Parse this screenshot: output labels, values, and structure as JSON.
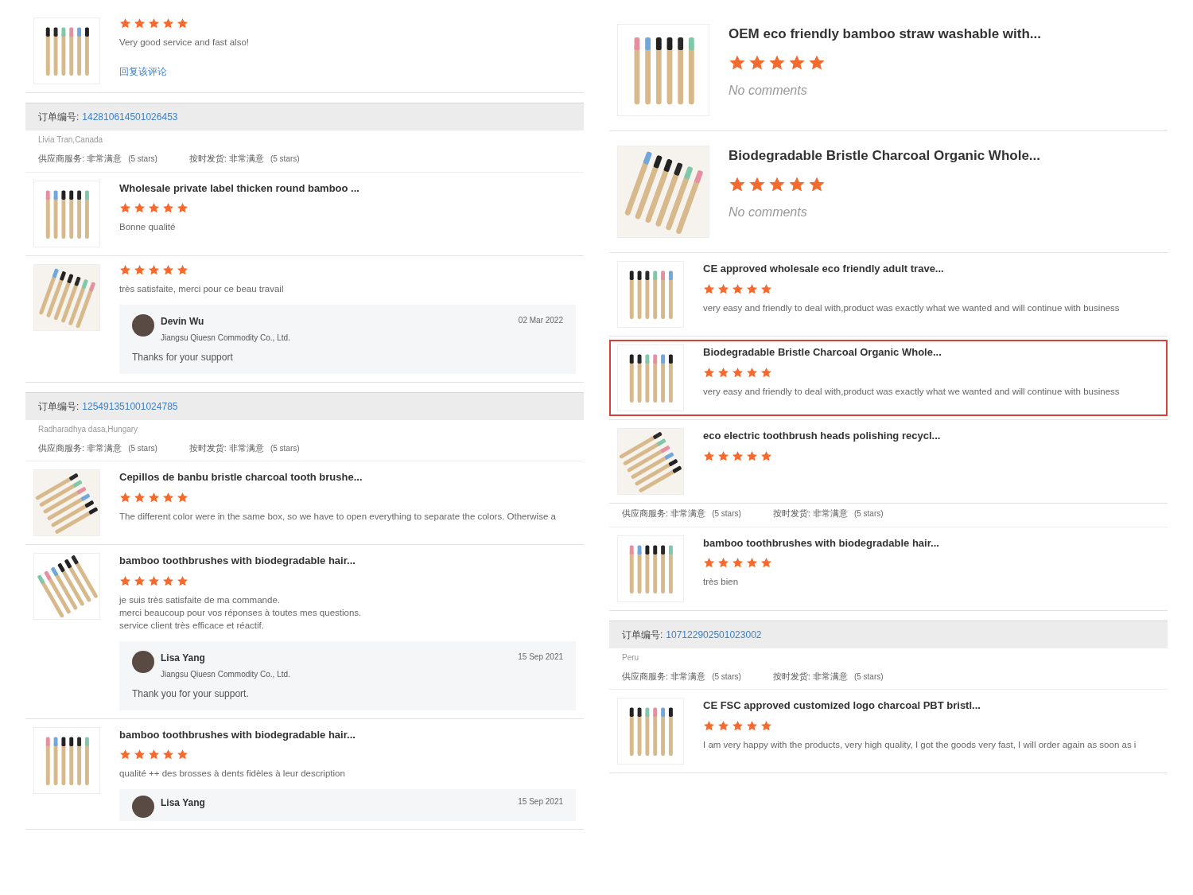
{
  "columns": [
    {
      "blocks": [
        {
          "kind": "review",
          "highlighted": false,
          "stars": 5,
          "comment": "Very good service and fast also!",
          "link": "回复该评论"
        },
        {
          "kind": "order",
          "label": "订单编号:",
          "number": "142810614501026453"
        },
        {
          "kind": "meta",
          "buyer": "Livia Tran,Canada",
          "ratings": [
            {
              "text": "供应商服务: 非常满意",
              "note": "(5 stars)"
            },
            {
              "text": "按时发货: 非常满意",
              "note": "(5 stars)"
            }
          ]
        },
        {
          "kind": "review",
          "highlighted": false,
          "title": "Wholesale private label thicken round bamboo ...",
          "stars": 5,
          "comment": "Bonne qualité"
        },
        {
          "kind": "review",
          "highlighted": false,
          "stars": 5,
          "comment": "très satisfaite, merci pour ce beau travail",
          "reply": {
            "name": "Devin Wu",
            "company": "Jiangsu Qiuesn Commodity Co., Ltd.",
            "date": "02 Mar 2022",
            "text": "Thanks for your support"
          }
        },
        {
          "kind": "order",
          "label": "订单编号:",
          "number": "125491351001024785"
        },
        {
          "kind": "meta",
          "buyer": "Radharadhya dasa,Hungary",
          "ratings": [
            {
              "text": "供应商服务: 非常满意",
              "note": "(5 stars)"
            },
            {
              "text": "按时发货: 非常满意",
              "note": "(5 stars)"
            }
          ]
        },
        {
          "kind": "review",
          "highlighted": false,
          "title": "Cepillos de banbu bristle charcoal tooth brushe...",
          "stars": 5,
          "comment": "The different color were in the same box, so we have to open everything to separate the colors. Otherwise a"
        },
        {
          "kind": "review",
          "highlighted": false,
          "title": "bamboo toothbrushes with biodegradable hair...",
          "stars": 5,
          "comment": "je suis très satisfaite de ma commande.\nmerci beaucoup pour vos réponses à toutes mes questions.\nservice client très efficace et réactif.",
          "reply": {
            "name": "Lisa Yang",
            "company": "Jiangsu Qiuesn Commodity Co., Ltd.",
            "date": "15 Sep 2021",
            "text": "Thank you for your support."
          }
        },
        {
          "kind": "review",
          "highlighted": false,
          "title": "bamboo toothbrushes with biodegradable hair...",
          "stars": 5,
          "comment": "qualité ++ des brosses à dents fidèles à leur description",
          "reply": {
            "name": "Lisa Yang",
            "date": "15 Sep 2021"
          }
        }
      ]
    },
    {
      "blocks": [
        {
          "kind": "review_large",
          "highlighted": false,
          "title": "OEM eco friendly bamboo straw washable with...",
          "stars": 5,
          "comment": "No comments"
        },
        {
          "kind": "review_large",
          "highlighted": false,
          "title": "Biodegradable Bristle Charcoal Organic Whole...",
          "stars": 5,
          "comment": "No comments"
        },
        {
          "kind": "review",
          "highlighted": false,
          "title": "CE approved wholesale eco friendly adult trave...",
          "stars": 5,
          "comment": "very easy and friendly to deal with,product was exactly what we wanted and will continue with business"
        },
        {
          "kind": "review",
          "highlighted": true,
          "title": "Biodegradable Bristle Charcoal Organic Whole...",
          "stars": 5,
          "comment": "very easy and friendly to deal with,product was exactly what we wanted and will continue with business"
        },
        {
          "kind": "review",
          "highlighted": false,
          "title": "eco electric toothbrush heads polishing recycl...",
          "stars": 5
        },
        {
          "kind": "meta",
          "ratings": [
            {
              "text": "供应商服务: 非常满意",
              "note": "(5 stars)"
            },
            {
              "text": "按时发货: 非常满意",
              "note": "(5 stars)"
            }
          ]
        },
        {
          "kind": "review",
          "highlighted": false,
          "title": "bamboo toothbrushes with biodegradable hair...",
          "stars": 5,
          "comment": "très bien"
        },
        {
          "kind": "order",
          "label": "订单编号:",
          "number": "107122902501023002"
        },
        {
          "kind": "meta",
          "buyer": "Peru",
          "ratings": [
            {
              "text": "供应商服务: 非常满意",
              "note": "(5 stars)"
            },
            {
              "text": "按时发货: 非常满意",
              "note": "(5 stars)"
            }
          ]
        },
        {
          "kind": "review",
          "highlighted": false,
          "title": "CE FSC approved customized logo charcoal PBT bristl...",
          "stars": 5,
          "comment": "I am very happy with the products, very high quality, I got the goods very fast, I will order again as soon as i"
        }
      ]
    }
  ]
}
